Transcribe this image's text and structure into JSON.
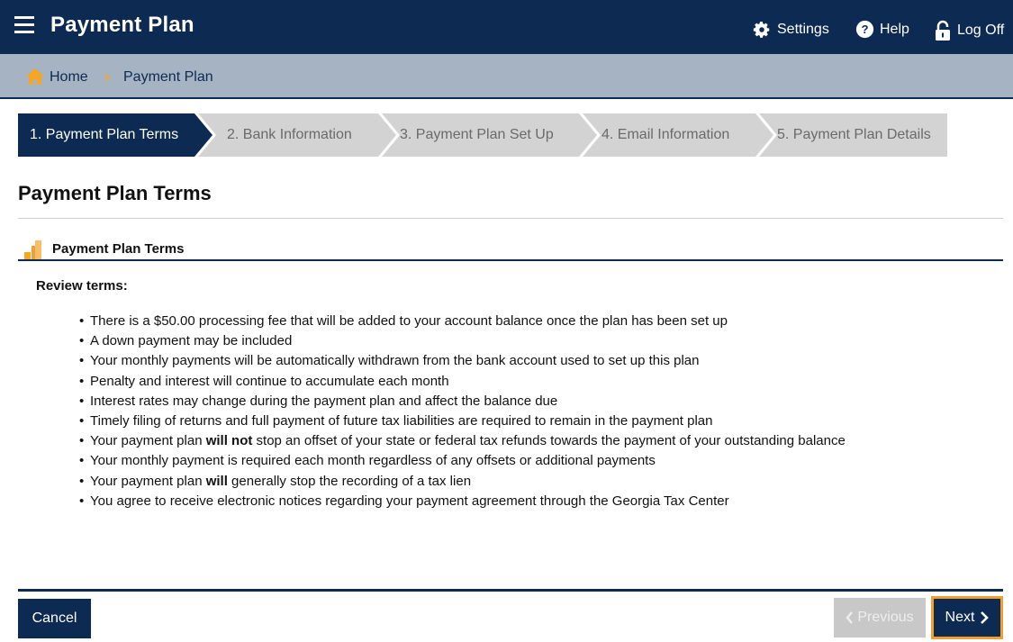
{
  "header": {
    "title": "Payment Plan",
    "settings_label": "Settings",
    "help_label": "Help",
    "logoff_label": "Log Off"
  },
  "breadcrumb": {
    "home": "Home",
    "current": "Payment Plan"
  },
  "steps": [
    {
      "label": "1. Payment Plan Terms",
      "active": true
    },
    {
      "label": "2. Bank Information",
      "active": false
    },
    {
      "label": "3. Payment Plan Set Up",
      "active": false
    },
    {
      "label": "4. Email Information",
      "active": false
    },
    {
      "label": "5. Payment Plan Details",
      "active": false
    }
  ],
  "page": {
    "title": "Payment Plan Terms",
    "section_title": "Payment Plan Terms",
    "review_label": "Review terms:"
  },
  "terms": [
    "There is a $50.00 processing fee that will be added to your account balance once the plan has been set up",
    "A down payment may be included",
    "Your monthly payments will be automatically withdrawn from the bank account used to set up this plan",
    "Penalty and interest will continue to accumulate each month",
    "Interest rates may change during the payment plan and affect the balance due",
    "Timely filing of returns and full payment of future tax liabilities are required to remain in the payment plan",
    "Your payment plan will not stop an offset of your state or federal tax refunds towards the payment of your outstanding balance",
    "Your monthly payment is required each month regardless of any offsets or additional payments",
    "Your payment plan will generally stop the recording of a tax lien",
    "You agree to receive electronic notices regarding your payment agreement through the Georgia Tax Center"
  ],
  "terms_bold": {
    "t7_pre": "Your payment plan ",
    "t7_bold": "will not",
    "t7_post": " stop an offset of your state or federal tax refunds towards the payment of your outstanding balance",
    "t9_pre": "Your payment plan ",
    "t9_bold": "will",
    "t9_post": " generally stop the recording of a tax lien"
  },
  "footer": {
    "cancel_label": "Cancel",
    "previous_label": "Previous",
    "next_label": "Next"
  },
  "colors": {
    "navy": "#0d2a52",
    "breadcrumb_bg": "#a6b3c2",
    "accent_orange": "#f0a030",
    "step_inactive": "#d3d3d3"
  },
  "icons": [
    "menu-icon",
    "gear-icon",
    "help-icon",
    "lock-icon",
    "home-icon",
    "chevron-right-icon",
    "coins-icon",
    "chevron-left-icon"
  ]
}
